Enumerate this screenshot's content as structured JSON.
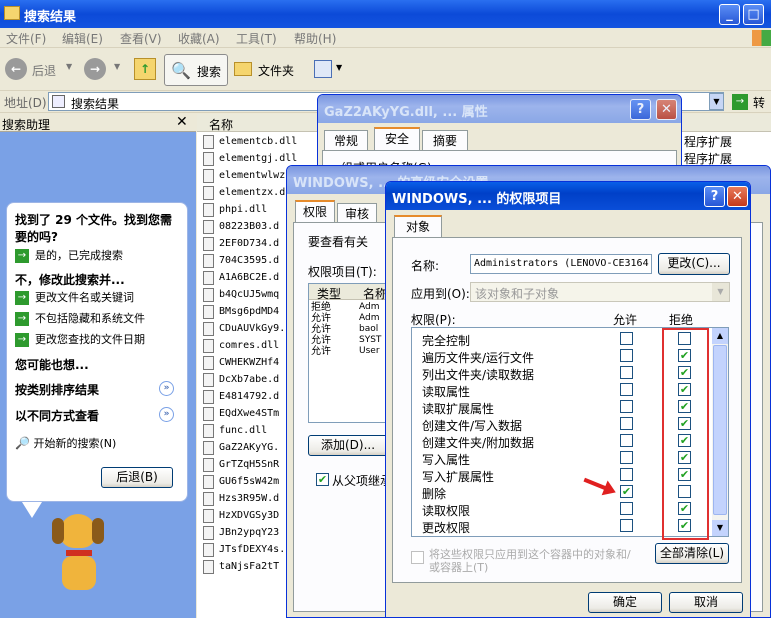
{
  "explorer": {
    "title": "搜索结果",
    "menu": [
      "文件(F)",
      "编辑(E)",
      "查看(V)",
      "收藏(A)",
      "工具(T)",
      "帮助(H)"
    ],
    "toolbar": {
      "back": "后退",
      "search": "搜索",
      "folders": "文件夹"
    },
    "address_label": "地址(D)",
    "address_value": "搜索结果",
    "go": "转到",
    "panel_title": "搜索助理",
    "col_name": "名称",
    "right_col": [
      "程序扩展",
      "程序扩展"
    ],
    "files": [
      "elementcb.dll",
      "elementgj.dll",
      "elementwlwz",
      "elementzx.d",
      "phpi.dll",
      "08223B03.d",
      "2EF0D734.d",
      "704C3595.d",
      "A1A6BC2E.d",
      "b4QcUJ5wmq",
      "BMsg6pdMD4",
      "CDuAUVkGy9.",
      "comres.dll",
      "CWHEKWZHf4",
      "DcXb7abe.d",
      "E4814792.d",
      "EQdXwe4STm",
      "func.dll",
      "GaZ2AKyYG.",
      "GrTZqH5SnR",
      "GU6f5sW42m",
      "Hzs3R95W.d",
      "HzXDVGSy3D",
      "JBn2ypqY23",
      "JTsfDEXY4s.",
      "taNjsFa2tT"
    ]
  },
  "assistant": {
    "found": "找到了 29 个文件。找到您需要的吗?",
    "yes": "是的，已完成搜索",
    "no_header": "不，修改此搜索并...",
    "opt1": "更改文件名或关键词",
    "opt2": "不包括隐藏和系统文件",
    "opt3": "更改您查找的文件日期",
    "maybe": "您可能也想...",
    "sort": "按类别排序结果",
    "view": "以不同方式查看",
    "new_search": "开始新的搜索(N)",
    "back": "后退(B)"
  },
  "props": {
    "title": "GaZ2AKyYG.dll, ... 属性",
    "tabs": [
      "常规",
      "安全",
      "摘要"
    ],
    "label": "组或用户名称(G):"
  },
  "adv": {
    "title": "WINDOWS, ... 的高级安全设置",
    "tabs": [
      "权限",
      "审核"
    ],
    "intro": "要查看有关",
    "entries_label": "权限项目(T):",
    "cols": [
      "类型",
      "名称"
    ],
    "rows": [
      [
        "拒绝",
        "Adm"
      ],
      [
        "允许",
        "Adm"
      ],
      [
        "允许",
        "baol"
      ],
      [
        "允许",
        "SYST"
      ],
      [
        "允许",
        "User"
      ]
    ],
    "add": "添加(D)...",
    "inherit": "从父项继承"
  },
  "perm": {
    "title": "WINDOWS, ... 的权限项目",
    "tab": "对象",
    "name_label": "名称:",
    "name_value": "Administrators (LENOVO-CE3164",
    "change": "更改(C)...",
    "apply_label": "应用到(O):",
    "apply_value": "该对象和子对象",
    "perm_label": "权限(P):",
    "allow": "允许",
    "deny": "拒绝",
    "rows": [
      {
        "name": "完全控制",
        "allow": false,
        "deny": false
      },
      {
        "name": "遍历文件夹/运行文件",
        "allow": false,
        "deny": true
      },
      {
        "name": "列出文件夹/读取数据",
        "allow": false,
        "deny": true
      },
      {
        "name": "读取属性",
        "allow": false,
        "deny": true
      },
      {
        "name": "读取扩展属性",
        "allow": false,
        "deny": true
      },
      {
        "name": "创建文件/写入数据",
        "allow": false,
        "deny": true
      },
      {
        "name": "创建文件夹/附加数据",
        "allow": false,
        "deny": true
      },
      {
        "name": "写入属性",
        "allow": false,
        "deny": true
      },
      {
        "name": "写入扩展属性",
        "allow": false,
        "deny": true
      },
      {
        "name": "删除",
        "allow": true,
        "deny": false
      },
      {
        "name": "读取权限",
        "allow": false,
        "deny": true
      },
      {
        "name": "更改权限",
        "allow": false,
        "deny": true
      }
    ],
    "apply_only": "将这些权限只应用到这个容器中的对象和/或容器上(T)",
    "clear": "全部清除(L)",
    "ok": "确定",
    "cancel": "取消"
  }
}
